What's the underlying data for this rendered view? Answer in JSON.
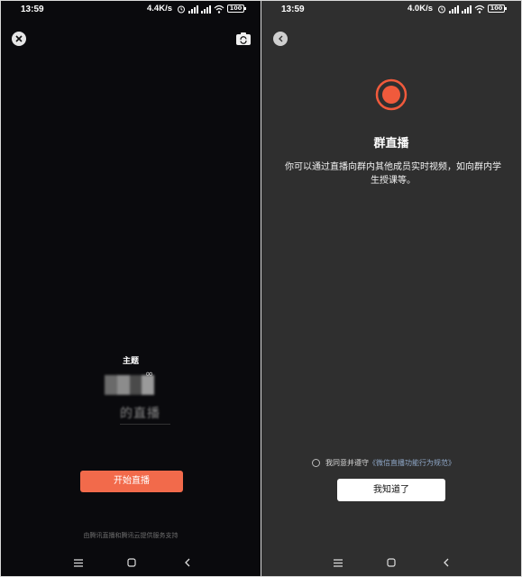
{
  "left_screen": {
    "status_bar": {
      "time": "13:59",
      "net_speed": "4.4K/s",
      "battery": "100"
    },
    "topic_label": "主题",
    "topic_title_blurred": "的直播",
    "start_button": "开始直播",
    "footer_note": "由腾讯直播和腾讯云提供服务支持",
    "icons": [
      "close-icon",
      "camera-switch-icon"
    ]
  },
  "right_screen": {
    "status_bar": {
      "time": "13:59",
      "net_speed": "4.0K/s",
      "battery": "100"
    },
    "title": "群直播",
    "description": "你可以通过直播向群内其他成员实时视频，如向群内学生授课等。",
    "agreement_prefix": "我同意并遵守",
    "agreement_link": "《微信直播功能行为规范》",
    "ok_button": "我知道了",
    "icons": [
      "back-icon",
      "record-icon"
    ]
  },
  "colors": {
    "accent": "#f26a4b",
    "record": "#f05a3c",
    "link": "#8ea6c6",
    "dark_bg": "#2f2f2f",
    "black_bg": "#0a0a0d"
  }
}
